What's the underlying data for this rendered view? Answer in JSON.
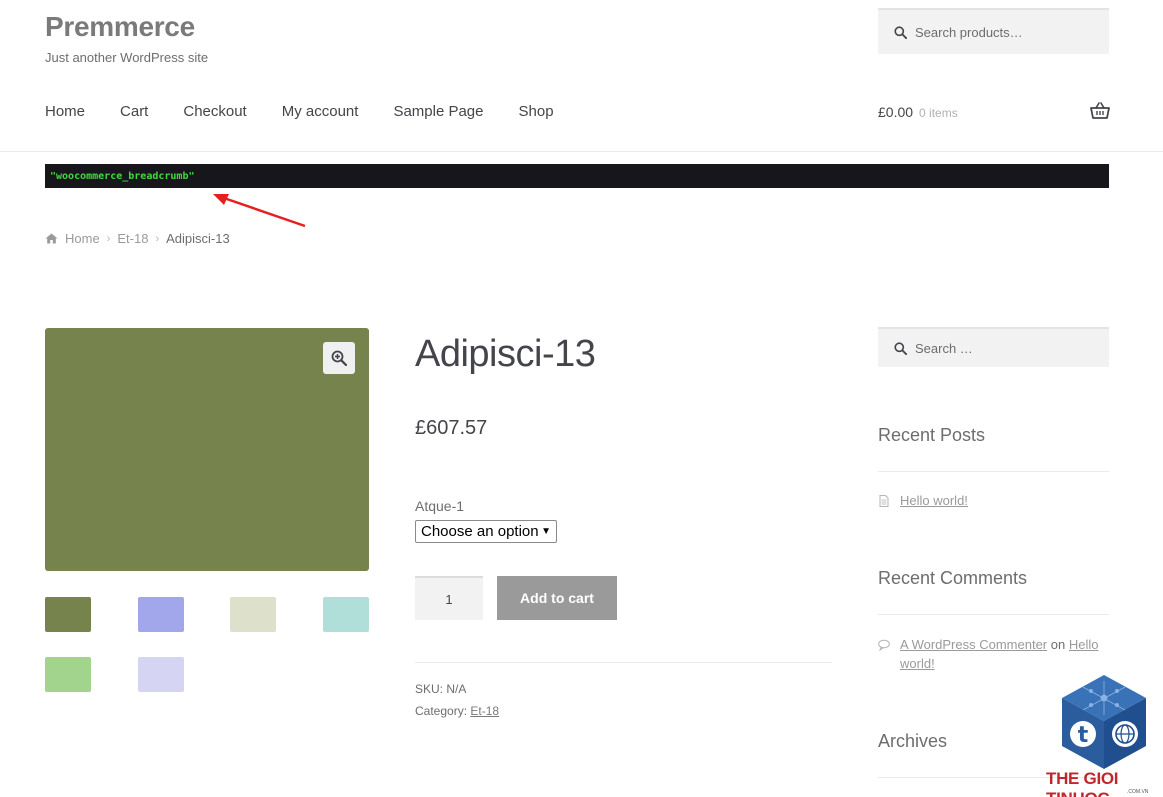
{
  "site": {
    "title": "Premmerce",
    "description": "Just another WordPress site"
  },
  "header": {
    "search_placeholder": "Search products…",
    "nav": [
      "Home",
      "Cart",
      "Checkout",
      "My account",
      "Sample Page",
      "Shop"
    ],
    "cart_amount": "£0.00",
    "cart_count": "0 items"
  },
  "annotation": {
    "code_text": "\"woocommerce_breadcrumb\""
  },
  "breadcrumb": {
    "home": "Home",
    "parent": "Et-18",
    "current": "Adipisci-13"
  },
  "product": {
    "title": "Adipisci-13",
    "price": "£607.57",
    "variation_label": "Atque-1",
    "variation_select": "Choose an option",
    "quantity": "1",
    "add_to_cart": "Add to cart",
    "sku_label": "SKU:",
    "sku_value": "N/A",
    "category_label": "Category:",
    "category_value": "Et-18",
    "main_image_color": "#76834d",
    "thumbnails": [
      "#76834d",
      "#a2a6ea",
      "#dde1cb",
      "#b0dfda",
      "#a3d48e",
      "#d5d5f3"
    ]
  },
  "sidebar": {
    "search_placeholder": "Search …",
    "recent_posts_title": "Recent Posts",
    "recent_posts": [
      "Hello world!"
    ],
    "recent_comments_title": "Recent Comments",
    "comment_author": "A WordPress Commenter",
    "comment_on": "on",
    "comment_post": "Hello world!",
    "archives_title": "Archives"
  },
  "watermark": {
    "brand": "THE GIOI TINHOC",
    "domain": ".COM.VN"
  },
  "colors": {
    "code_bar_bg": "#17171b",
    "code_text": "#43d843",
    "arrow": "#e52020",
    "button_bg": "#9a9a9a"
  }
}
